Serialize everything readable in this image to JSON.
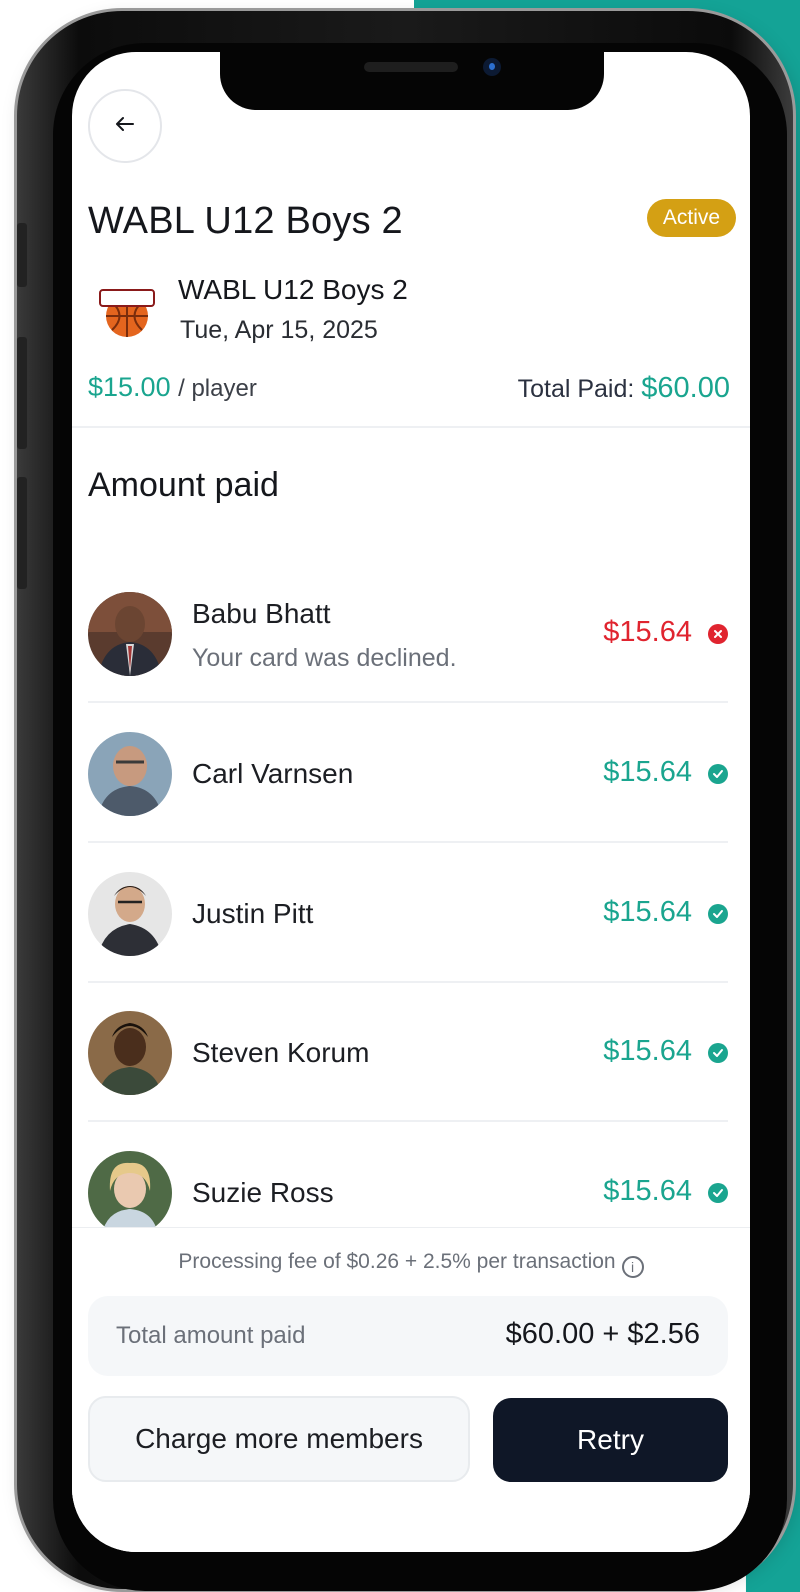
{
  "header": {
    "back_icon": "arrow-left-icon",
    "title": "WABL U12 Boys 2",
    "status_badge": "Active",
    "status_color": "#d4a014"
  },
  "event": {
    "team_name": "WABL U12 Boys 2",
    "date": "Tue, Apr 15, 2025",
    "logo_icon": "basketball-team-logo"
  },
  "pricing": {
    "per_player_amount": "$15.00",
    "per_player_unit": "/ player",
    "total_paid_label": "Total Paid:",
    "total_paid_value": "$60.00",
    "accent_color": "#1aa58f"
  },
  "section": {
    "title": "Amount paid"
  },
  "members": [
    {
      "name": "Babu Bhatt",
      "subtitle": "Your card was declined.",
      "amount": "$15.64",
      "status": "declined",
      "status_icon": "x-circle-icon"
    },
    {
      "name": "Carl Varnsen",
      "subtitle": "",
      "amount": "$15.64",
      "status": "paid",
      "status_icon": "check-circle-icon"
    },
    {
      "name": "Justin Pitt",
      "subtitle": "",
      "amount": "$15.64",
      "status": "paid",
      "status_icon": "check-circle-icon"
    },
    {
      "name": "Steven Korum",
      "subtitle": "",
      "amount": "$15.64",
      "status": "paid",
      "status_icon": "check-circle-icon"
    },
    {
      "name": "Suzie Ross",
      "subtitle": "",
      "amount": "$15.64",
      "status": "paid",
      "status_icon": "check-circle-icon"
    }
  ],
  "footer": {
    "fee_note": "Processing fee of $0.26 + 2.5% per transaction",
    "info_icon": "info-icon",
    "total_label": "Total amount paid",
    "total_value": "$60.00 + $2.56",
    "secondary_button": "Charge more members",
    "primary_button": "Retry",
    "primary_color": "#0f1727",
    "error_color": "#e0242f"
  }
}
